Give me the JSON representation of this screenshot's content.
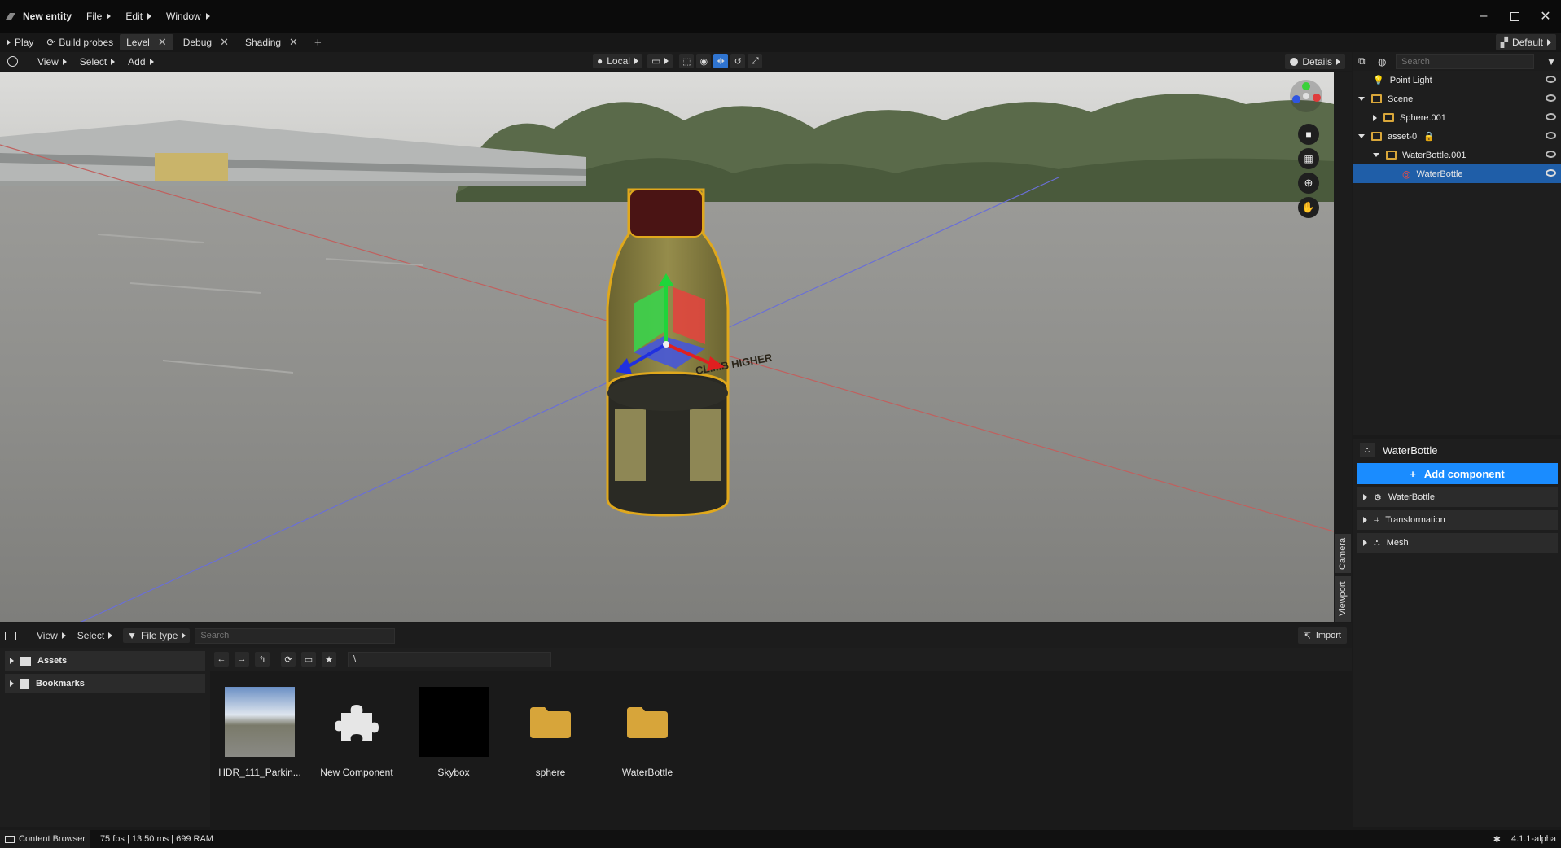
{
  "titlebar": {
    "app_title": "New entity",
    "menus": [
      "File",
      "Edit",
      "Window"
    ]
  },
  "tabbar": {
    "play_label": "Play",
    "build_probes_label": "Build probes",
    "tabs": [
      "Level",
      "Debug",
      "Shading"
    ],
    "add_tab": "+",
    "layout_label": "Default"
  },
  "viewport_toolbar": {
    "view": "View",
    "select": "Select",
    "add": "Add",
    "space": "Local",
    "details": "Details"
  },
  "viewport": {
    "side_tabs": [
      "Camera",
      "Viewport"
    ],
    "bottle_label": "CLIMB HIGHER"
  },
  "hierarchy": {
    "search_placeholder": "Search",
    "items": [
      {
        "label": "Point Light",
        "type": "light"
      },
      {
        "label": "Scene",
        "type": "folder"
      },
      {
        "label": "Sphere.001",
        "type": "folder"
      },
      {
        "label": "asset-0",
        "type": "folder",
        "locked": true
      },
      {
        "label": "WaterBottle.001",
        "type": "folder"
      },
      {
        "label": "WaterBottle",
        "type": "mesh",
        "selected": true
      }
    ]
  },
  "properties": {
    "entity_name": "WaterBottle",
    "add_component_label": "Add component",
    "sections": [
      "WaterBottle",
      "Transformation",
      "Mesh"
    ],
    "accent": "#1a8cff"
  },
  "content_browser": {
    "view": "View",
    "select": "Select",
    "file_type": "File type",
    "search_placeholder": "Search",
    "import_label": "Import",
    "path": "\\",
    "tree": [
      "Assets",
      "Bookmarks"
    ],
    "items": [
      {
        "label": "HDR_111_Parkin...",
        "kind": "hdr"
      },
      {
        "label": "New Component",
        "kind": "component"
      },
      {
        "label": "Skybox",
        "kind": "skybox"
      },
      {
        "label": "sphere",
        "kind": "folder"
      },
      {
        "label": "WaterBottle",
        "kind": "folder"
      }
    ]
  },
  "statusbar": {
    "tab_label": "Content Browser",
    "stats": "75 fps | 13.50 ms | 699 RAM",
    "version": "4.1.1-alpha"
  }
}
